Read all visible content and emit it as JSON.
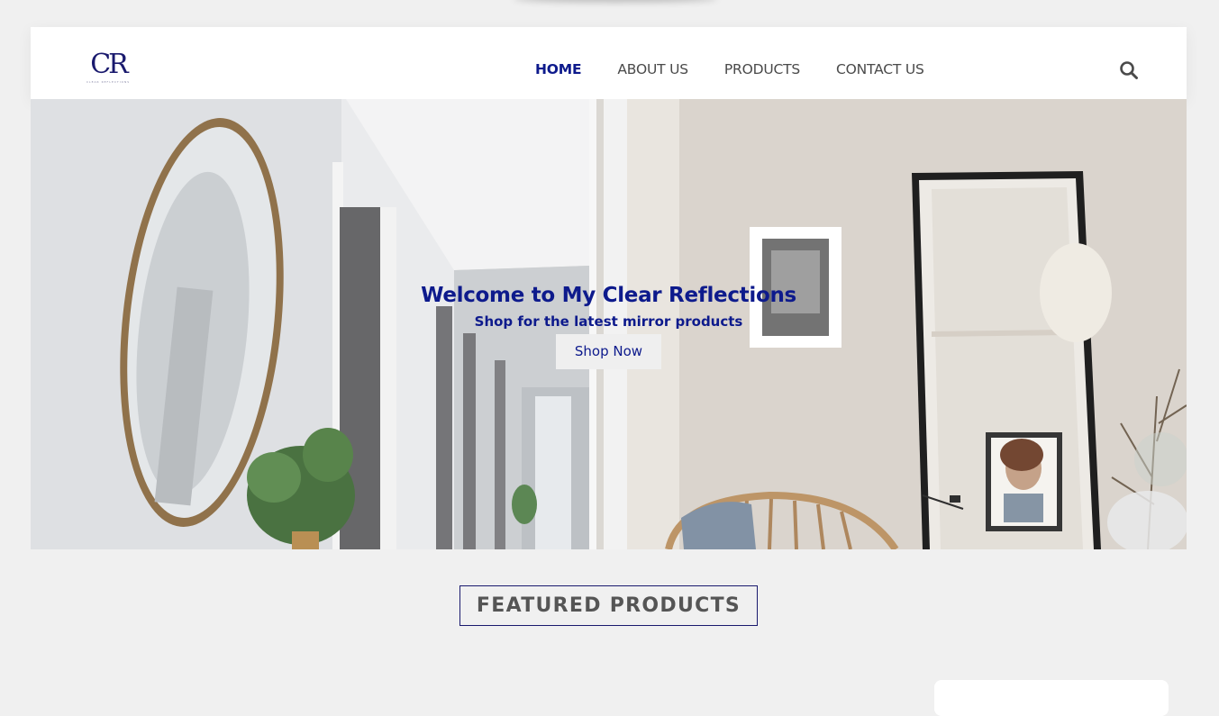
{
  "brand": {
    "logo_mark": "CR",
    "logo_tagline": "CLEAR REFLECTIONS"
  },
  "nav": {
    "items": [
      {
        "label": "HOME",
        "active": true
      },
      {
        "label": "ABOUT US",
        "active": false
      },
      {
        "label": "PRODUCTS",
        "active": false
      },
      {
        "label": "CONTACT US",
        "active": false
      }
    ],
    "search_icon": "search-icon"
  },
  "hero": {
    "title": "Welcome to My Clear Reflections",
    "subtitle": "Shop for the latest mirror products",
    "cta_label": "Shop Now"
  },
  "sections": {
    "featured_title": "FEATURED PRODUCTS"
  },
  "colors": {
    "accent": "#0d1a8c",
    "nav_text": "#4a4a4a",
    "page_bg": "#f0f0f0"
  }
}
